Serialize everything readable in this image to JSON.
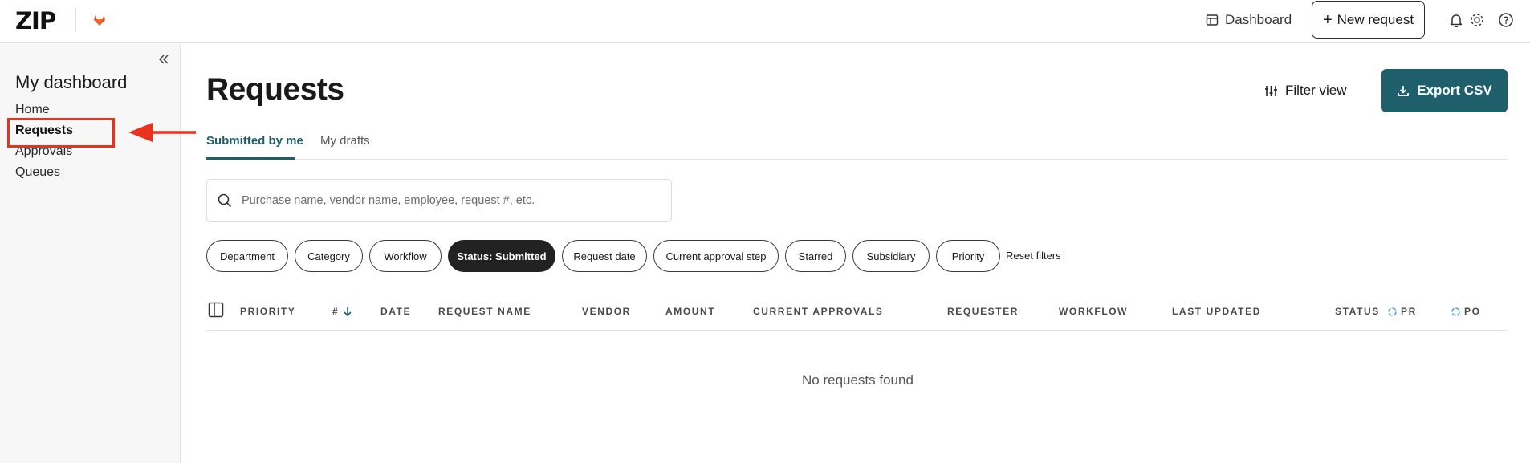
{
  "header": {
    "logo": "ZIP",
    "dashboard_label": "Dashboard",
    "new_request_label": "New request"
  },
  "sidebar": {
    "title": "My dashboard",
    "items": [
      {
        "label": "Home"
      },
      {
        "label": "Requests"
      },
      {
        "label": "Approvals"
      },
      {
        "label": "Queues"
      }
    ]
  },
  "main": {
    "title": "Requests",
    "filter_view_label": "Filter view",
    "export_label": "Export CSV",
    "tabs": [
      {
        "label": "Submitted by me"
      },
      {
        "label": "My drafts"
      }
    ],
    "search": {
      "placeholder": "Purchase name, vendor name, employee, request #, etc."
    },
    "filters": [
      {
        "label": "Department"
      },
      {
        "label": "Category"
      },
      {
        "label": "Workflow"
      },
      {
        "label": "Status: Submitted"
      },
      {
        "label": "Request date"
      },
      {
        "label": "Current approval step"
      },
      {
        "label": "Starred"
      },
      {
        "label": "Subsidiary"
      },
      {
        "label": "Priority"
      }
    ],
    "reset_filters_label": "Reset filters",
    "columns": [
      {
        "label": "PRIORITY"
      },
      {
        "label": "#"
      },
      {
        "label": "DATE"
      },
      {
        "label": "REQUEST NAME"
      },
      {
        "label": "VENDOR"
      },
      {
        "label": "AMOUNT"
      },
      {
        "label": "CURRENT APPROVALS"
      },
      {
        "label": "REQUESTER"
      },
      {
        "label": "WORKFLOW"
      },
      {
        "label": "LAST UPDATED"
      },
      {
        "label": "STATUS"
      },
      {
        "label": "PR"
      },
      {
        "label": "PO"
      }
    ],
    "empty_message": "No requests found"
  },
  "colors": {
    "accent": "#1f5f6b",
    "annotation": "#e8321e",
    "chip_active": "#222222"
  }
}
